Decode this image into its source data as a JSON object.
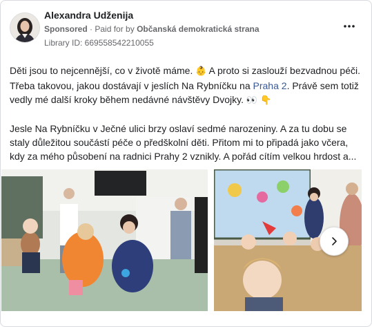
{
  "post": {
    "author": "Alexandra Udženija",
    "sponsored_label": "Sponsored",
    "paid_for_prefix": "Paid for by",
    "paid_for_by": "Občanská demokratická strana",
    "library_id": "Library ID: 669558542210055",
    "more_icon": "more-horizontal-icon",
    "text": {
      "p1_a": "Děti jsou to nejcennější, co v životě máme.",
      "p1_emoji_baby": "👶",
      "p1_b": " A proto si zaslouží bezvadnou péči. Třeba takovou, jakou dostávají v jeslích Na Rybníčku na ",
      "p1_link": "Praha 2",
      "p1_c": ". Právě sem totiž vedly mé další kroky během nedávné návštěvy Dvojky.",
      "p1_emoji_eyes": "👀",
      "p1_emoji_point": "👇",
      "p2": "Jesle Na Rybníčku v Ječné ulici brzy oslaví sedmé narozeniny. A za tu dobu se staly důležitou součástí péče o předškolní děti. Přitom mi to připadá jako včera, kdy za mého působení na radnici Prahy 2 vznikly. A pořád cítím velkou hrdost a..."
    },
    "carousel": {
      "next_icon": "chevron-right-icon"
    }
  },
  "colors": {
    "text": "#1c1e21",
    "secondary": "#65676b",
    "link": "#385898",
    "border": "#d8dadf"
  }
}
